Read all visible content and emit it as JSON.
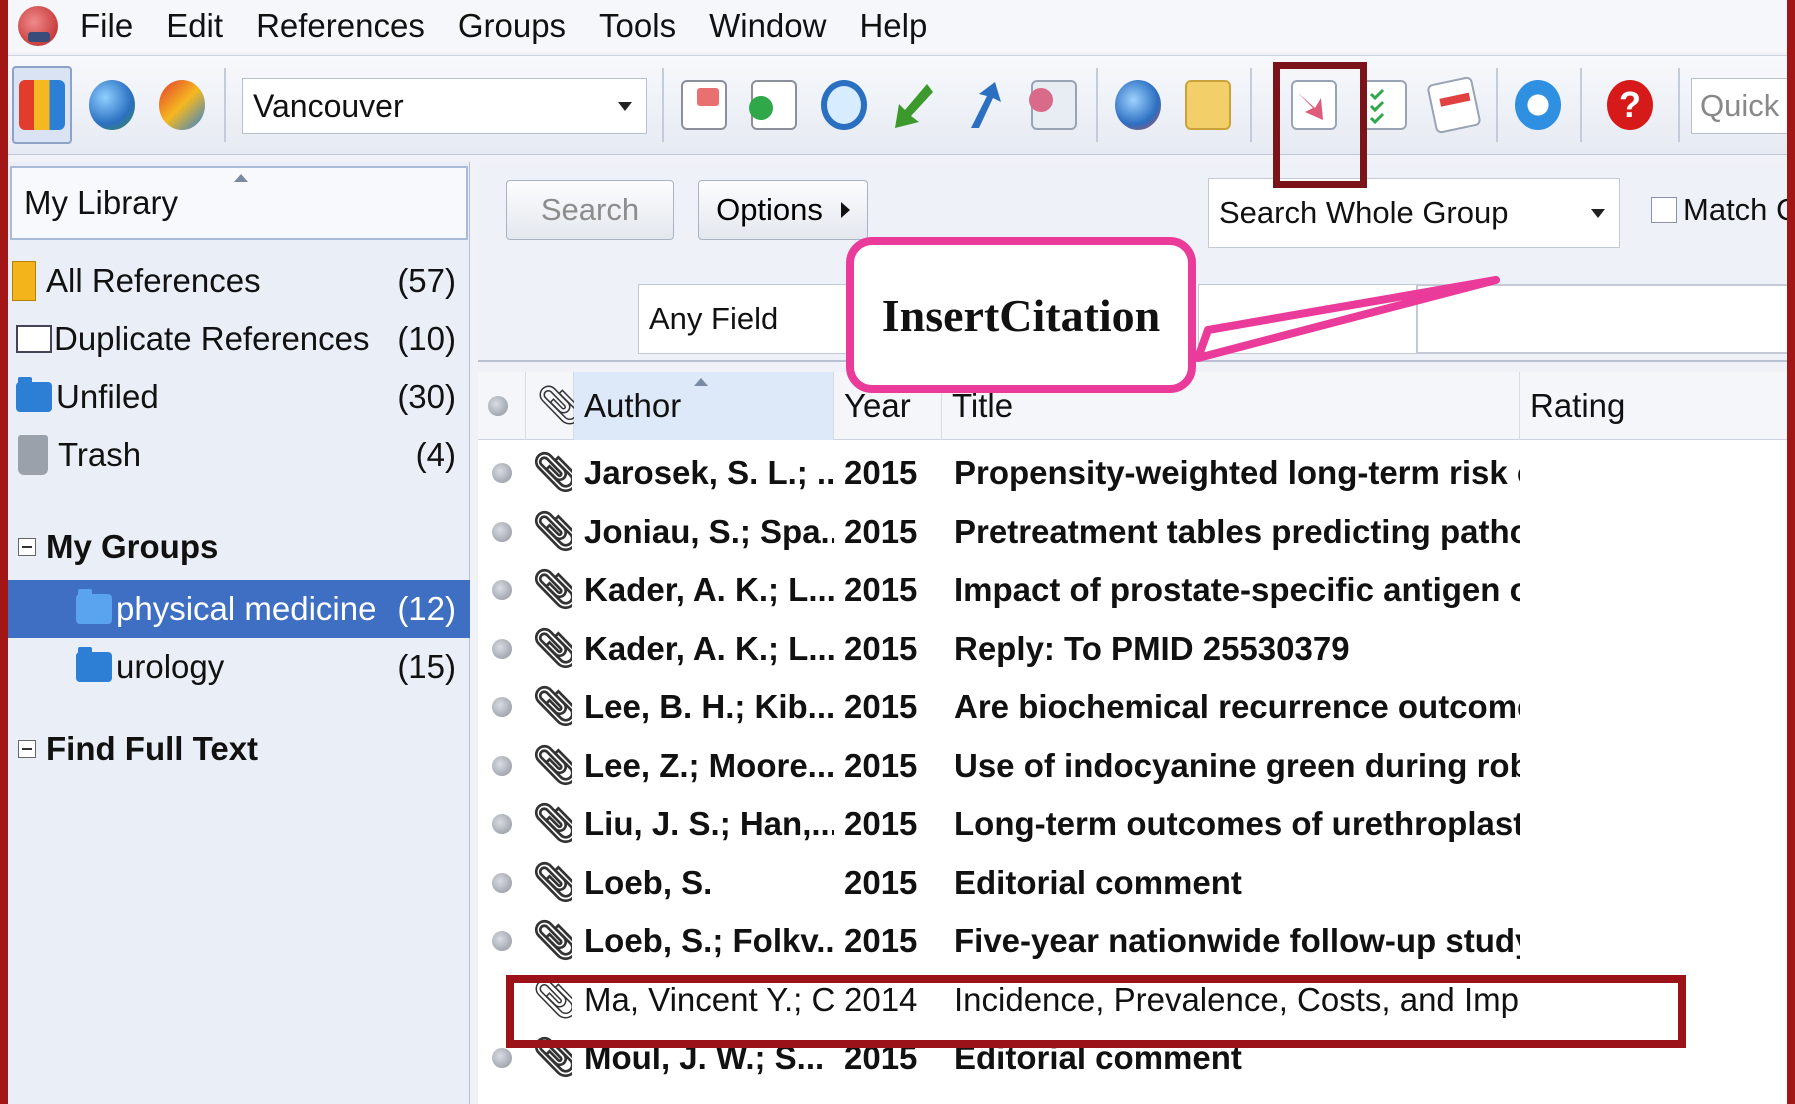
{
  "menu": [
    "File",
    "Edit",
    "References",
    "Groups",
    "Tools",
    "Window",
    "Help"
  ],
  "toolbar": {
    "style": "Vancouver",
    "quick_search_placeholder": "Quick S",
    "icons": [
      "local-library-icon",
      "online-search-icon",
      "integrated-library-icon",
      "copy-formatted-icon",
      "new-reference-icon",
      "online-search-magnifier-icon",
      "import-icon",
      "export-icon",
      "find-full-text-icon",
      "open-link-icon",
      "open-file-icon",
      "insert-citation-icon",
      "format-bibliography-icon",
      "return-to-word-icon",
      "sync-icon",
      "help-icon"
    ]
  },
  "sidebar": {
    "header": "My Library",
    "items": [
      {
        "label": "All References",
        "count": "(57)"
      },
      {
        "label": "Duplicate References",
        "count": "(10)"
      },
      {
        "label": "Unfiled",
        "count": "(30)"
      },
      {
        "label": "Trash",
        "count": "(4)"
      }
    ],
    "my_groups_label": "My Groups",
    "groups": [
      {
        "label": "physical medicine",
        "count": "(12)"
      },
      {
        "label": "urology",
        "count": "(15)"
      }
    ],
    "find_full_text_label": "Find Full Text"
  },
  "search": {
    "search_button": "Search",
    "options_button": "Options",
    "scope": "Search Whole Group",
    "match_case": "Match Ca",
    "field": "Any Field"
  },
  "callout": "InsertCitation",
  "table": {
    "columns": [
      "Author",
      "Year",
      "Title",
      "Rating"
    ],
    "rows": [
      {
        "author": "Jarosek, S. L.; ...",
        "year": "2015",
        "title": "Propensity-weighted long-term risk of ur..."
      },
      {
        "author": "Joniau, S.; Spa...",
        "year": "2015",
        "title": "Pretreatment tables predicting pathologi..."
      },
      {
        "author": "Kader, A. K.; L...",
        "year": "2015",
        "title": "Impact of prostate-specific antigen on a ..."
      },
      {
        "author": "Kader, A. K.; L...",
        "year": "2015",
        "title": "Reply: To PMID 25530379"
      },
      {
        "author": "Lee, B. H.; Kib...",
        "year": "2015",
        "title": "Are biochemical recurrence outcomes si..."
      },
      {
        "author": "Lee, Z.; Moore...",
        "year": "2015",
        "title": "Use of indocyanine green during robot-a..."
      },
      {
        "author": "Liu, J. S.; Han,...",
        "year": "2015",
        "title": "Long-term outcomes of urethroplasty wi..."
      },
      {
        "author": "Loeb, S.",
        "year": "2015",
        "title": "Editorial comment"
      },
      {
        "author": "Loeb, S.; Folkv...",
        "year": "2015",
        "title": "Five-year nationwide follow-up study of ..."
      },
      {
        "author": "Ma, Vincent Y.; C...",
        "year": "2014",
        "title": "Incidence, Prevalence, Costs, and Impact on Disa..."
      },
      {
        "author": "Moul, J. W.; S...",
        "year": "2015",
        "title": "Editorial comment"
      }
    ]
  },
  "colors": {
    "frame": "#a31616",
    "highlight_box": "#9b1218",
    "callout_border": "#ea3a9a",
    "selection": "#3e6fc2"
  }
}
